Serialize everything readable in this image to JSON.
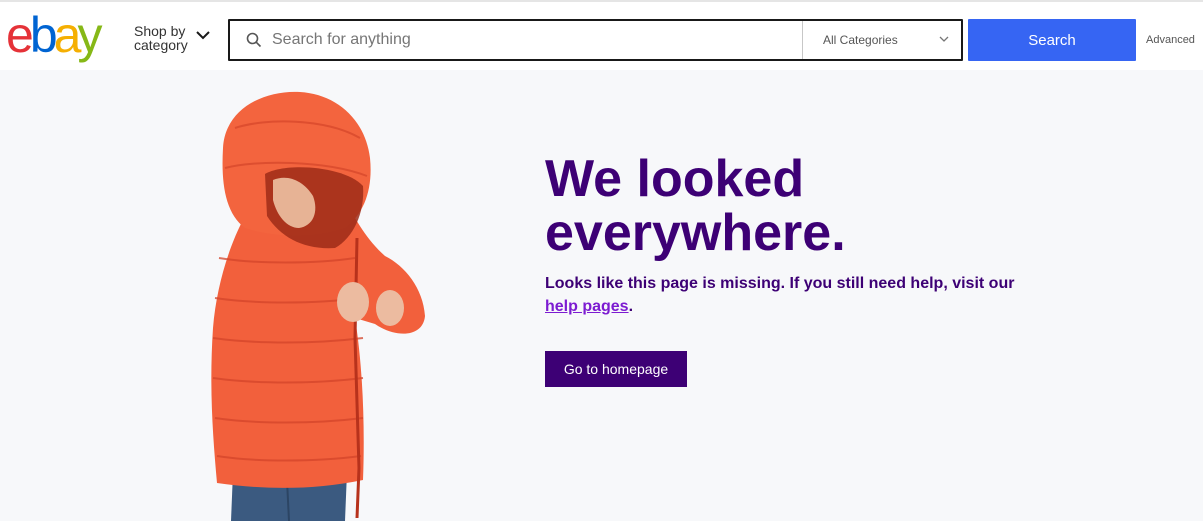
{
  "header": {
    "logo_letters": [
      "e",
      "b",
      "a",
      "y"
    ],
    "logo_colors": [
      "#e53238",
      "#0064d2",
      "#f5af02",
      "#86b817"
    ],
    "shop_by_line1": "Shop by",
    "shop_by_line2": "category",
    "search_placeholder": "Search for anything",
    "search_value": "",
    "category_selected": "All Categories",
    "search_button": "Search",
    "advanced_link": "Advanced",
    "search_button_color": "#3665f3"
  },
  "main": {
    "headline_line1": "We looked",
    "headline_line2": "everywhere.",
    "message": "Looks like this page is missing. If you still need help, visit our",
    "help_link": "help pages",
    "message_end": ".",
    "homepage_button": "Go to homepage",
    "accent_color": "#3d0075",
    "link_color": "#7c1bd1"
  }
}
